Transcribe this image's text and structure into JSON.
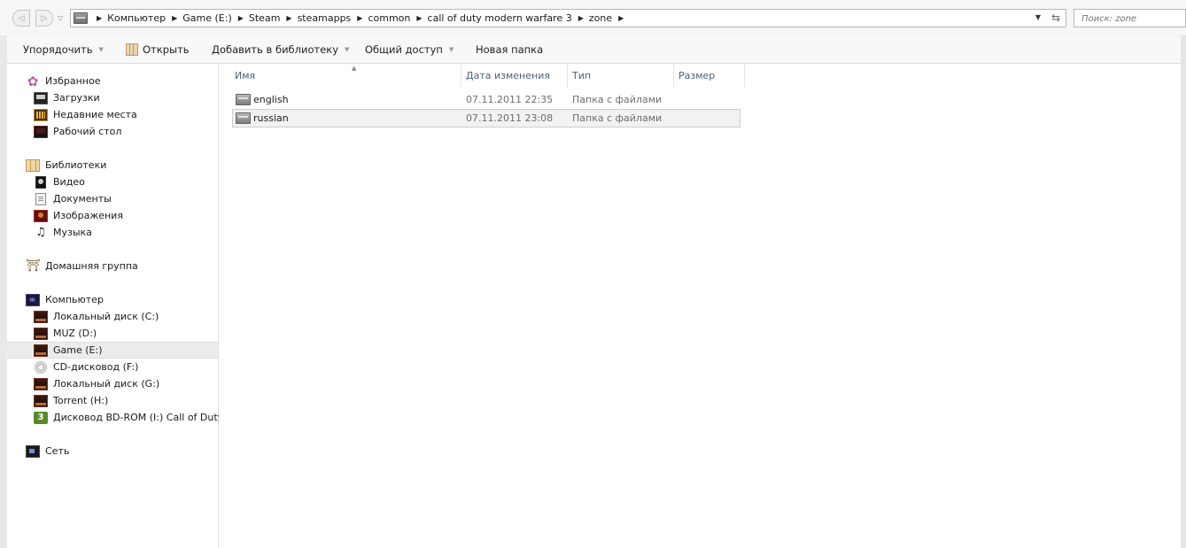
{
  "address": {
    "back_icon": "back-arrow-icon",
    "forward_icon": "forward-arrow-icon",
    "crumbs": [
      "Компьютер",
      "Game (E:)",
      "Steam",
      "steamapps",
      "common",
      "call of duty modern warfare 3",
      "zone"
    ],
    "search_placeholder": "Поиск: zone"
  },
  "toolbar": {
    "organize": "Упорядочить",
    "open": "Открыть",
    "add_to_library": "Добавить в библиотеку",
    "share": "Общий доступ",
    "new_folder": "Новая папка"
  },
  "nav": {
    "favorites": {
      "label": "Избранное",
      "items": [
        "Загрузки",
        "Недавние места",
        "Рабочий стол"
      ]
    },
    "libraries": {
      "label": "Библиотеки",
      "items": [
        "Видео",
        "Документы",
        "Изображения",
        "Музыка"
      ]
    },
    "homegroup": {
      "label": "Домашняя группа"
    },
    "computer": {
      "label": "Компьютер",
      "items": [
        "Локальный диск (C:)",
        "MUZ (D:)",
        "Game (E:)",
        "CD-дисковод (F:)",
        "Локальный диск (G:)",
        "Torrent (H:)",
        "Дисковод BD-ROM (I:) Call of Duty®"
      ],
      "selected": "Game (E:)"
    },
    "network": {
      "label": "Сеть"
    }
  },
  "columns": {
    "name": "Имя",
    "modified": "Дата изменения",
    "type": "Тип",
    "size": "Размер"
  },
  "files": [
    {
      "name": "english",
      "modified": "07.11.2011 22:35",
      "type": "Папка с файлами",
      "size": ""
    },
    {
      "name": "russian",
      "modified": "07.11.2011 23:08",
      "type": "Папка с файлами",
      "size": ""
    }
  ]
}
